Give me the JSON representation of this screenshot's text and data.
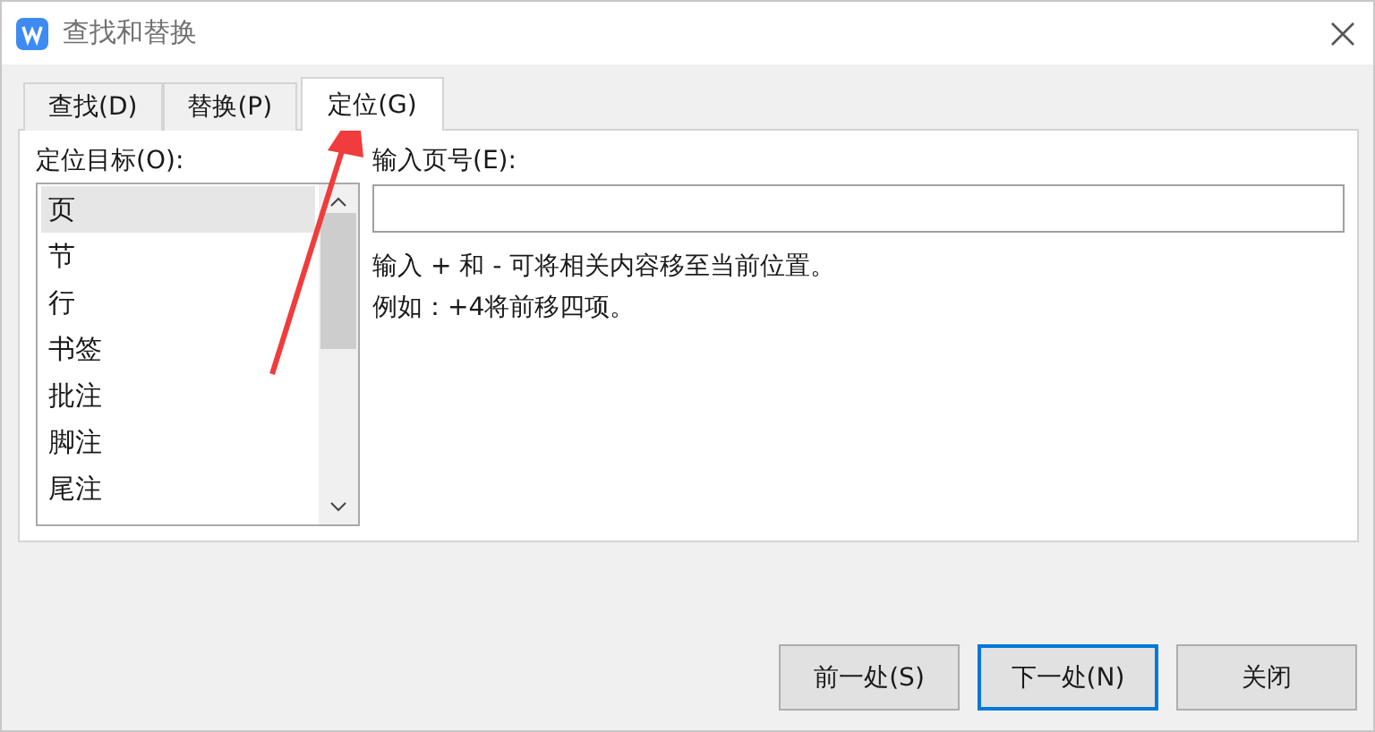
{
  "window": {
    "title": "查找和替换"
  },
  "tabs": [
    {
      "label": "查找(D)",
      "selected": false
    },
    {
      "label": "替换(P)",
      "selected": false
    },
    {
      "label": "定位(G)",
      "selected": true
    }
  ],
  "target": {
    "label": "定位目标(O):",
    "items": [
      {
        "label": "页",
        "selected": true
      },
      {
        "label": "节",
        "selected": false
      },
      {
        "label": "行",
        "selected": false
      },
      {
        "label": "书签",
        "selected": false
      },
      {
        "label": "批注",
        "selected": false
      },
      {
        "label": "脚注",
        "selected": false
      },
      {
        "label": "尾注",
        "selected": false
      }
    ]
  },
  "page_number": {
    "label": "输入页号(E):",
    "hint_lines": [
      "输入 + 和 - 可将相关内容移至当前位置。",
      "例如：+4将前移四项。"
    ]
  },
  "buttons": [
    {
      "label": "前一处(S)",
      "focused": false
    },
    {
      "label": "下一处(N)",
      "focused": true
    },
    {
      "label": "关闭",
      "focused": false
    }
  ]
}
